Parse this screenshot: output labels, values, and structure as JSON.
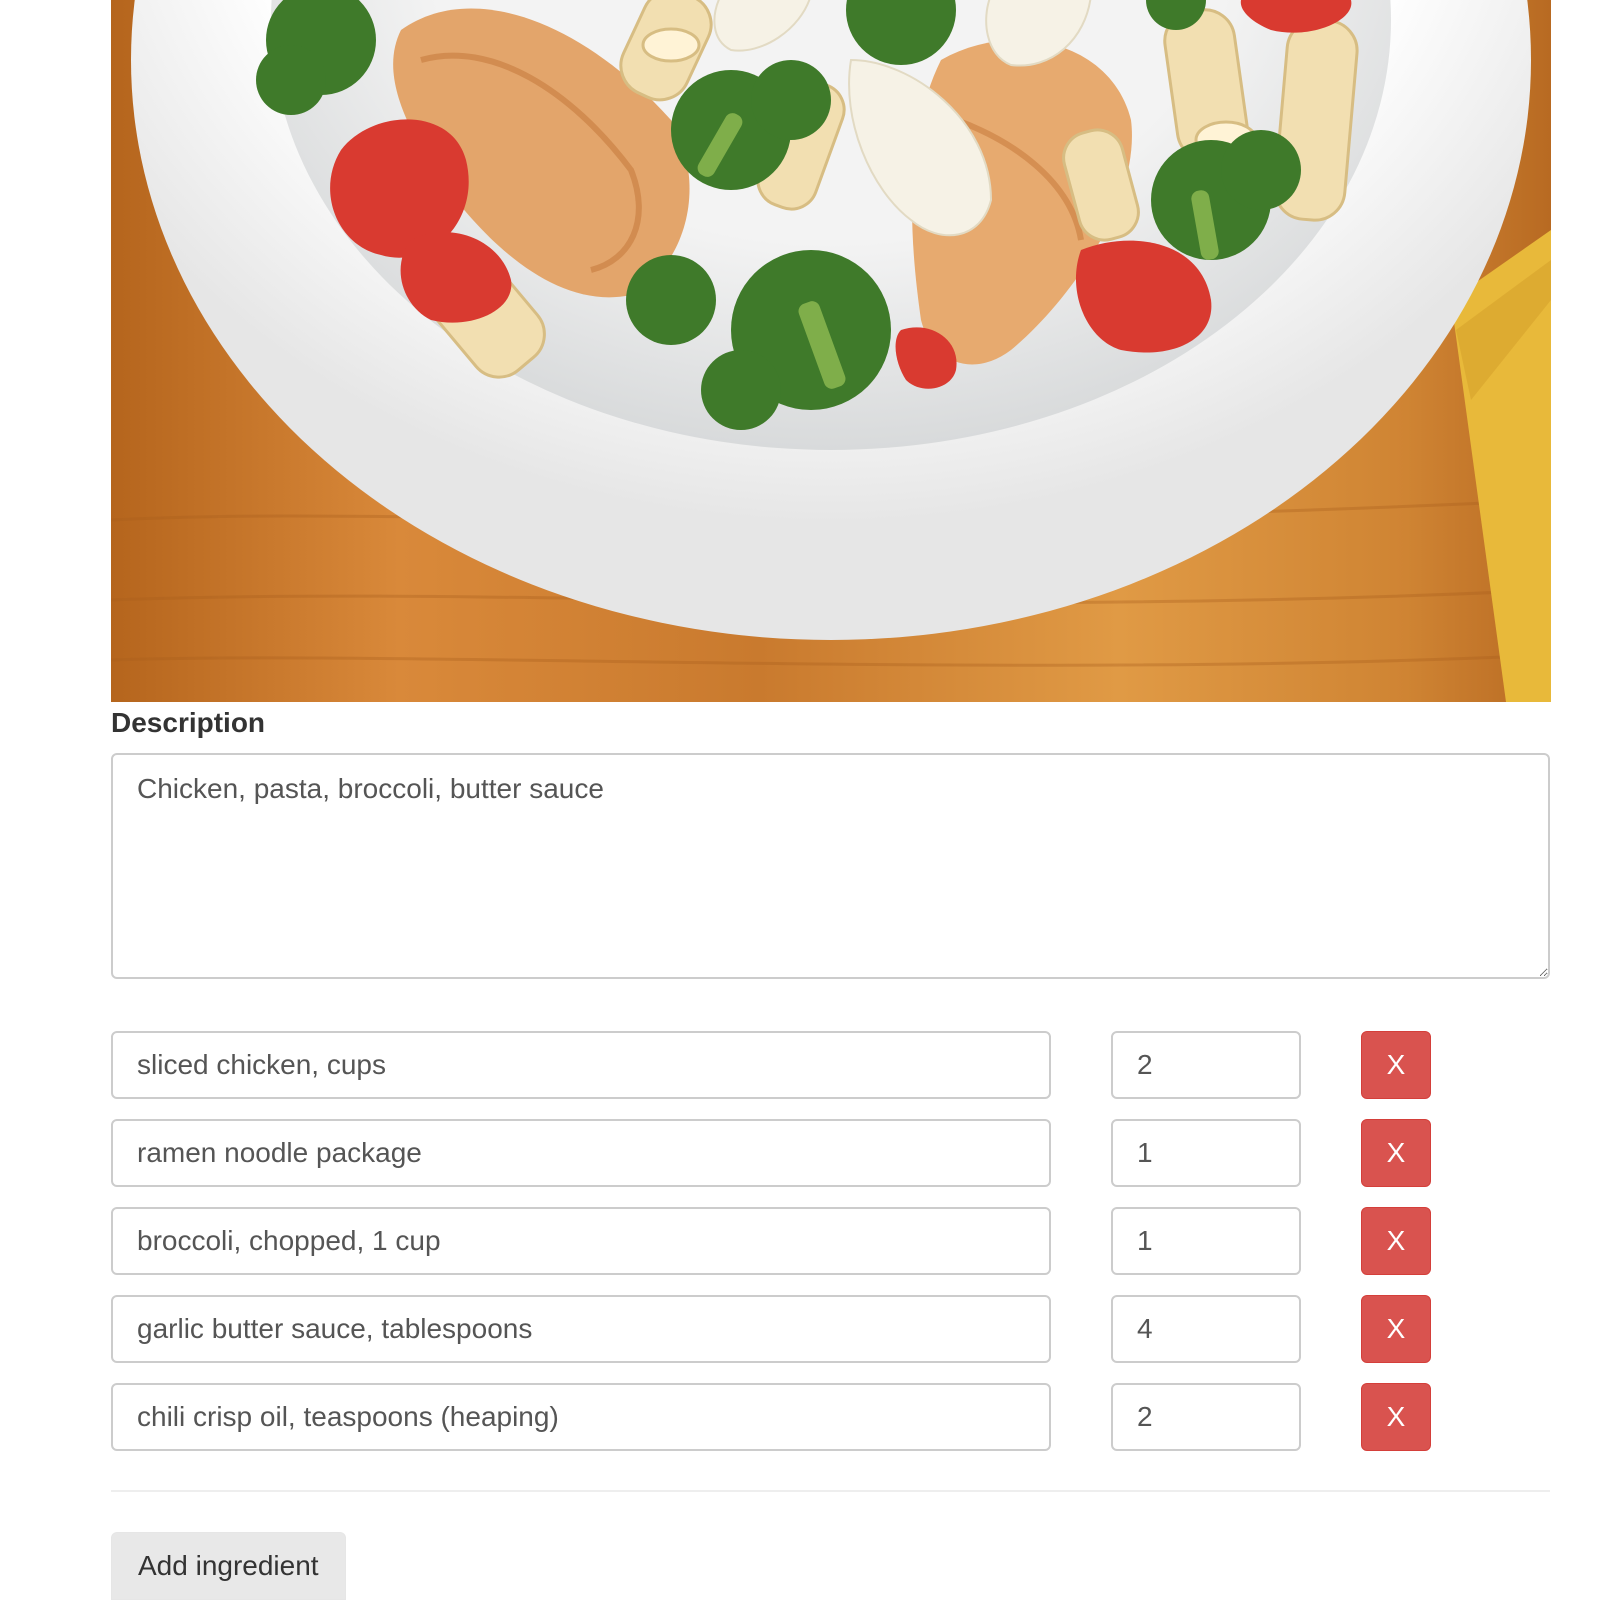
{
  "description": {
    "label": "Description",
    "value": "Chicken, pasta, broccoli, butter sauce"
  },
  "ingredients": [
    {
      "name": "sliced chicken, cups",
      "qty": "2",
      "remove_label": "X"
    },
    {
      "name": "ramen noodle package",
      "qty": "1",
      "remove_label": "X"
    },
    {
      "name": "broccoli, chopped, 1 cup",
      "qty": "1",
      "remove_label": "X"
    },
    {
      "name": "garlic butter sauce, tablespoons",
      "qty": "4",
      "remove_label": "X"
    },
    {
      "name": "chili crisp oil, teaspoons (heaping)",
      "qty": "2",
      "remove_label": "X"
    }
  ],
  "add_ingredient_label": "Add ingredient",
  "colors": {
    "danger": "#d9534f",
    "input_border": "#cccccc",
    "button_default": "#e8e8e8"
  },
  "icons": {
    "remove": "x-glyph"
  }
}
